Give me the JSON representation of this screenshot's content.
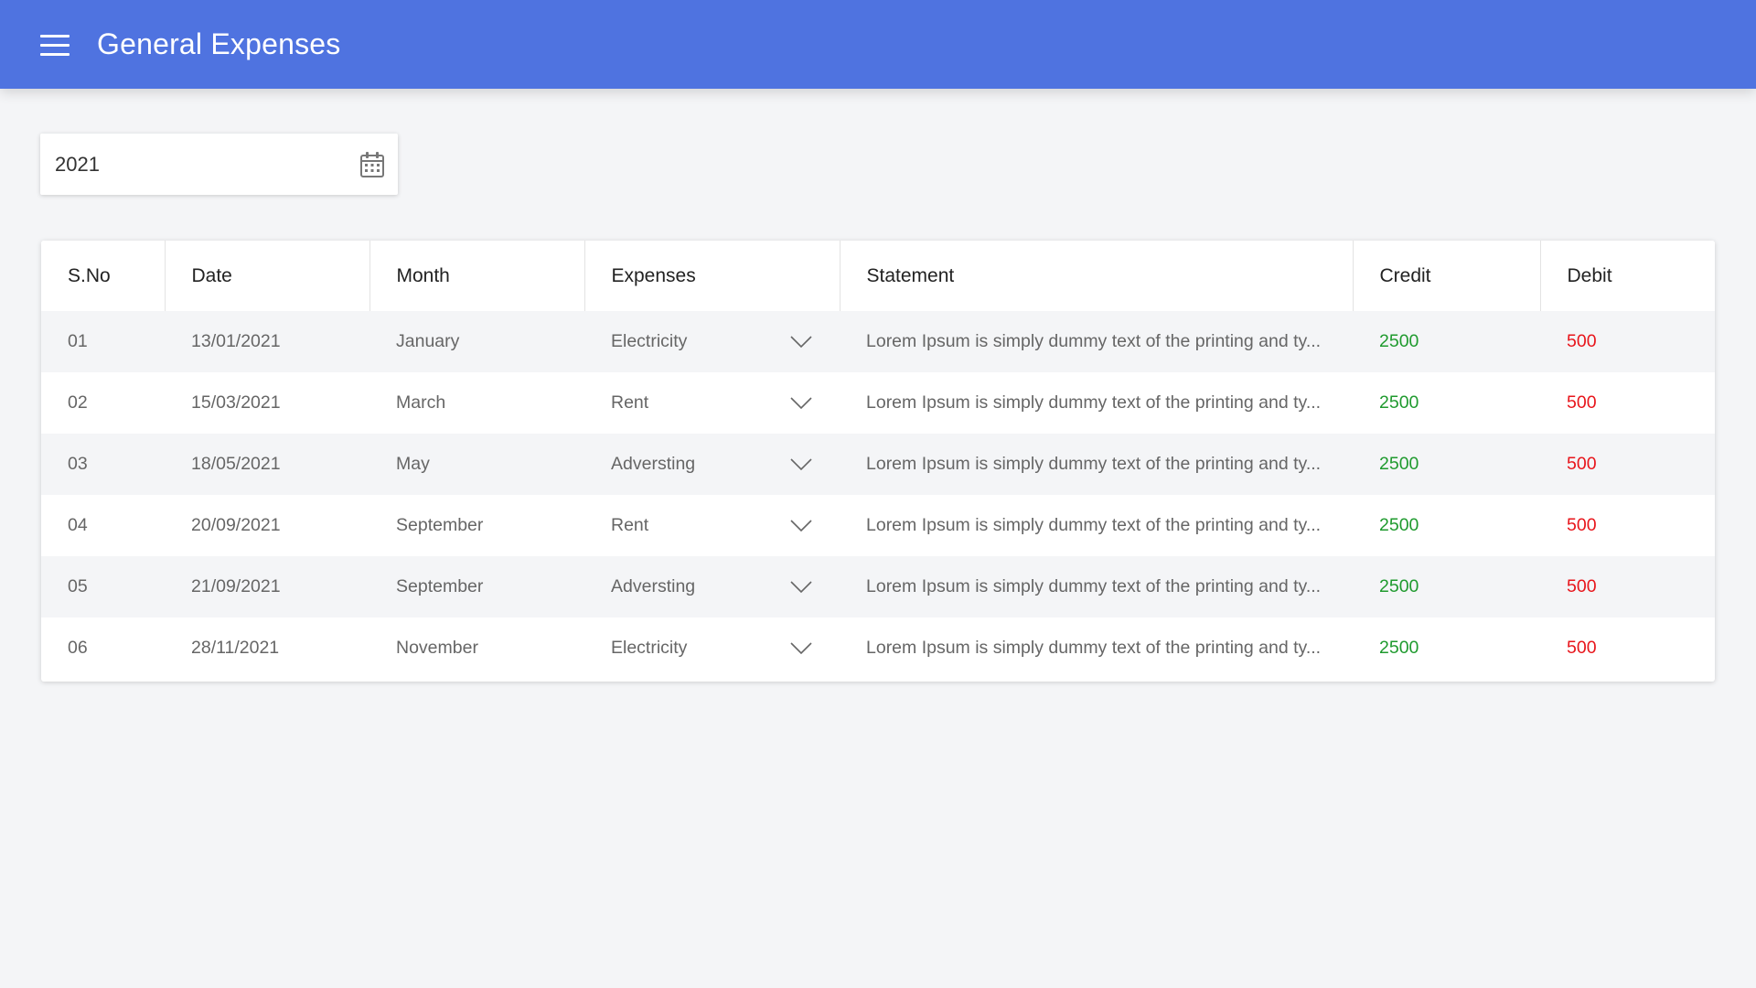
{
  "header": {
    "title": "General Expenses",
    "menu_icon": "hamburger-menu-icon",
    "background": "#4f73e0"
  },
  "year_picker": {
    "value": "2021",
    "icon": "calendar-icon"
  },
  "table": {
    "columns": [
      "S.No",
      "Date",
      "Month",
      "Expenses",
      "Statement",
      "Credit",
      "Debit"
    ],
    "rows": [
      {
        "sno": "01",
        "date": "13/01/2021",
        "month": "January",
        "expense": "Electricity",
        "statement": "Lorem Ipsum is simply dummy text of the printing and ty...",
        "credit": "2500",
        "debit": "500"
      },
      {
        "sno": "02",
        "date": "15/03/2021",
        "month": "March",
        "expense": "Rent",
        "statement": "Lorem Ipsum is simply dummy text of the printing and ty...",
        "credit": "2500",
        "debit": "500"
      },
      {
        "sno": "03",
        "date": "18/05/2021",
        "month": "May",
        "expense": "Adversting",
        "statement": "Lorem Ipsum is simply dummy text of the printing and ty...",
        "credit": "2500",
        "debit": "500"
      },
      {
        "sno": "04",
        "date": "20/09/2021",
        "month": "September",
        "expense": "Rent",
        "statement": "Lorem Ipsum is simply dummy text of the printing and ty...",
        "credit": "2500",
        "debit": "500"
      },
      {
        "sno": "05",
        "date": "21/09/2021",
        "month": "September",
        "expense": "Adversting",
        "statement": "Lorem Ipsum is simply dummy text of the printing and ty...",
        "credit": "2500",
        "debit": "500"
      },
      {
        "sno": "06",
        "date": "28/11/2021",
        "month": "November",
        "expense": "Electricity",
        "statement": "Lorem Ipsum is simply dummy text of the printing and ty...",
        "credit": "2500",
        "debit": "500"
      }
    ],
    "colors": {
      "credit": "#1f9a2e",
      "debit": "#e8151b"
    }
  }
}
